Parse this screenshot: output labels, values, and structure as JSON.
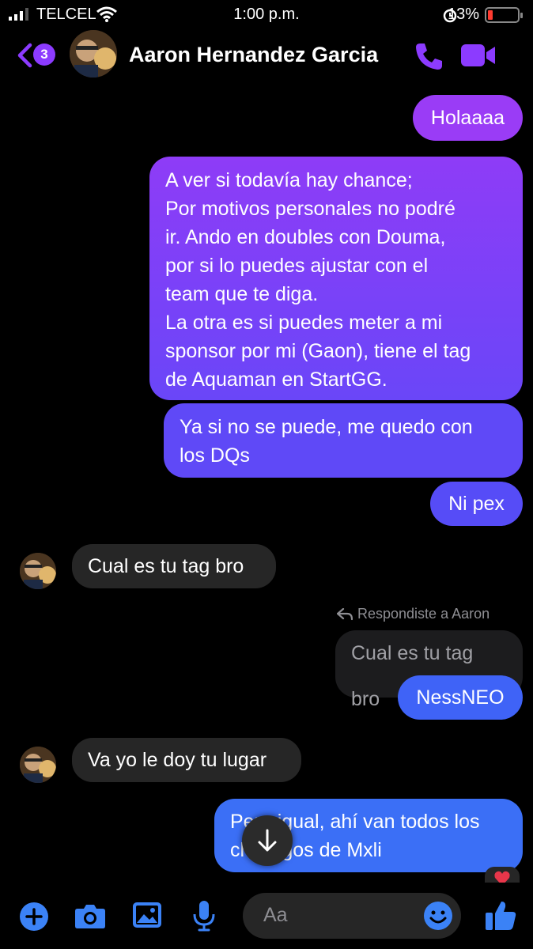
{
  "status_bar": {
    "carrier": "TELCEL",
    "time": "1:00 p.m.",
    "battery": "13%"
  },
  "header": {
    "back_count": "3",
    "contact_name": "Aaron Hernandez Garcia"
  },
  "messages": {
    "m1": "Holaaaa",
    "m2_lines": [
      "A ver si todavía hay chance;",
      "Por motivos personales no podré",
      "ir. Ando en doubles con Douma,",
      "por si lo puedes ajustar con el",
      "team que te diga.",
      "La otra es si puedes meter a mi",
      "sponsor por mi (Gaon), tiene el tag",
      "de Aquaman en StartGG."
    ],
    "m3_lines": [
      "Ya si no se puede, me quedo con",
      "los DQs"
    ],
    "m4": "Ni pex",
    "r1": "Cual es tu tag bro",
    "reply_label": "Respondiste a Aaron",
    "quoted": "Cual es tu tag bro",
    "m5": "NessNEO",
    "r2": "Va yo le doy tu lugar",
    "m6_lines": [
      "Pero igual, ahí van todos los",
      "chilangos de Mxli"
    ]
  },
  "composer": {
    "placeholder": "Aa"
  },
  "colors": {
    "accent": "#8c3bff",
    "bubble_top": "#9c3cf6",
    "bubble_bottom": "#3b6ff6",
    "received": "#262626"
  }
}
